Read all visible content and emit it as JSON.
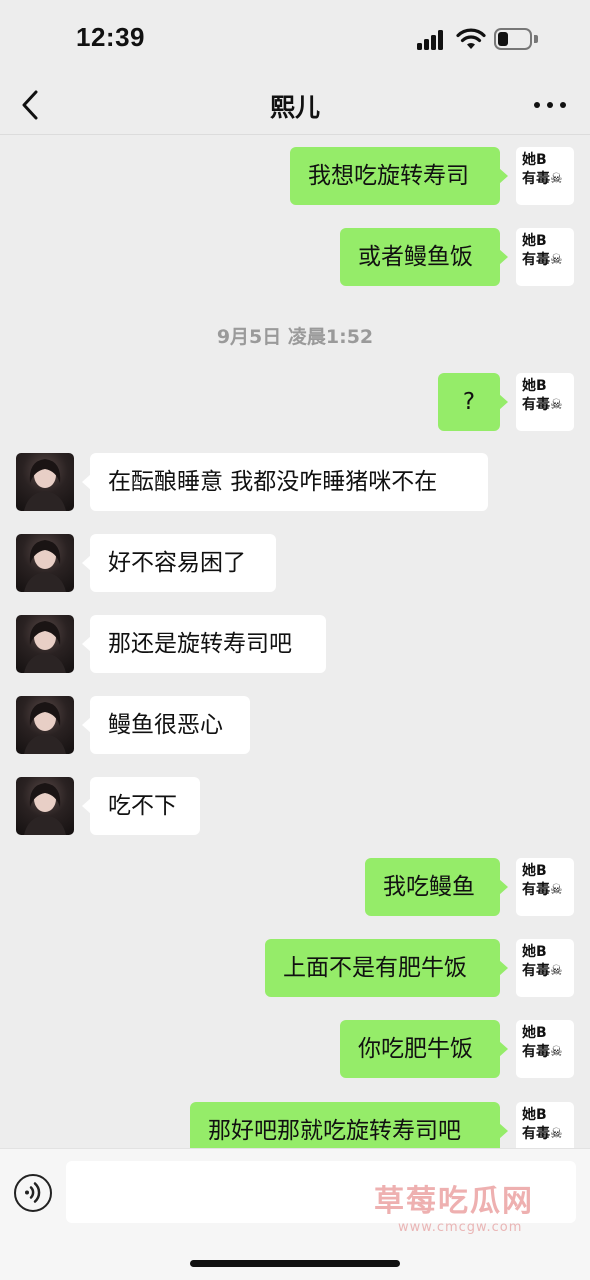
{
  "status_bar": {
    "time": "12:39"
  },
  "nav": {
    "title": "熙儿"
  },
  "my_avatar": {
    "line1": "她B",
    "line2": "有毒☠"
  },
  "timestamp": "9月5日 凌晨1:52",
  "messages": [
    {
      "sender": "me",
      "text": "我想吃旋转寿司"
    },
    {
      "sender": "me",
      "text": "或者鳗鱼饭"
    },
    {
      "sender": "me",
      "text": "?"
    },
    {
      "sender": "her",
      "text": "在酝酿睡意 我都没咋睡猪咪不在"
    },
    {
      "sender": "her",
      "text": "好不容易困了"
    },
    {
      "sender": "her",
      "text": "那还是旋转寿司吧"
    },
    {
      "sender": "her",
      "text": "鳗鱼很恶心"
    },
    {
      "sender": "her",
      "text": "吃不下"
    },
    {
      "sender": "me",
      "text": "我吃鳗鱼"
    },
    {
      "sender": "me",
      "text": "上面不是有肥牛饭"
    },
    {
      "sender": "me",
      "text": "你吃肥牛饭"
    },
    {
      "sender": "me",
      "text": "那好吧那就吃旋转寿司吧"
    }
  ],
  "input": {
    "value": ""
  },
  "watermark": {
    "text": "草莓吃瓜网",
    "url": "www.cmcgw.com"
  },
  "icons": {
    "back": "chevron-left-icon",
    "more": "more-dots-icon",
    "voice": "voice-icon",
    "avatar_her": "contact-avatar"
  },
  "colors": {
    "outgoing_bubble": "#95ec69",
    "incoming_bubble": "#ffffff",
    "background": "#ededed"
  }
}
